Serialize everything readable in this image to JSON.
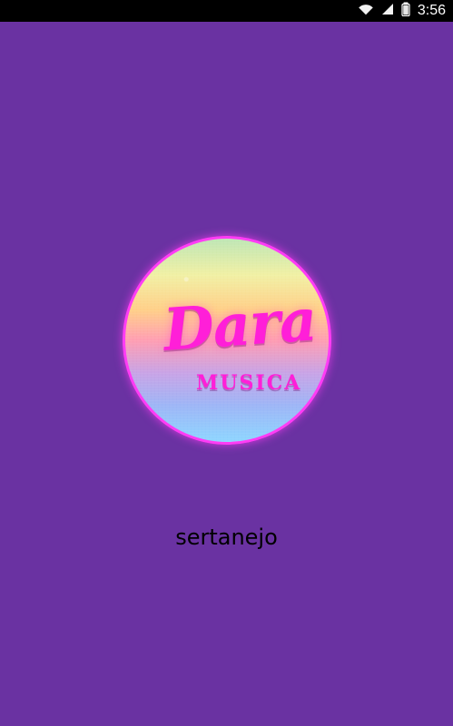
{
  "status_bar": {
    "time": "3:56",
    "icons": [
      "wifi-icon",
      "signal-icon",
      "battery-icon"
    ]
  },
  "splash": {
    "logo": {
      "title": "Dara",
      "subtitle": "MUSICA"
    },
    "genre_label": "sertanejo"
  },
  "colors": {
    "background": "#6a32a2",
    "status_bar": "#000000",
    "logo_text": "#ff1fd8",
    "logo_ring": "#ff3cf5"
  }
}
